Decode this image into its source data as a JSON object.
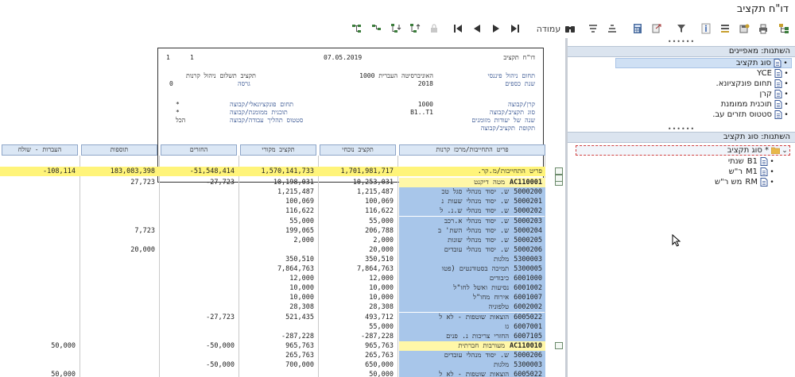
{
  "window": {
    "title": "דו\"ח תקציב"
  },
  "toolbar": {
    "page_label": "עמודה",
    "icons": [
      "refresh-icon",
      "print-icon",
      "export-icon",
      "calculator-icon",
      "sort-asc-icon",
      "sort-desc-icon",
      "binoculars-icon",
      "last-page-icon",
      "next-page-icon",
      "prev-page-icon",
      "first-page-icon",
      "hierarchy-icons"
    ]
  },
  "report_header": {
    "title": "דו\"ח תקציב",
    "date": "07.05.2019",
    "page_a": "1",
    "page_b": "1",
    "fields": [
      {
        "label": "תחום ניהול פיננסי",
        "value": "1000 האוניברסיטה העברית"
      },
      {
        "label": "שנת כספים",
        "value": "2018"
      },
      {
        "label": "תקציב תשלום ניהול קרנות",
        "value": ""
      },
      {
        "label": "גרסה",
        "value": "0"
      },
      {
        "label": "קרן/קבוצה",
        "value": "1000"
      },
      {
        "label": "סוג תקציב/קבוצה",
        "value": "B1..T1"
      },
      {
        "label": "שנה של יעודות מזומנים",
        "value": ""
      },
      {
        "label": "תקופת תקציב/קבוצה",
        "value": ""
      },
      {
        "label": "תחום פונקציונאלי/קבוצה",
        "value": "*"
      },
      {
        "label": "תוכנית ממומנת/קבוצה",
        "value": "*"
      },
      {
        "label": "סטטוס תהליך עבודה/קבוצה",
        "value": "הכל"
      }
    ]
  },
  "columns": {
    "name": "פריט התחייבות/מרכז קרנות",
    "current": "תקציב נוכחי",
    "original": "תקציב מקורי",
    "returns": "החזרים",
    "additions": "תוספות",
    "transfers": "העברות - שולח"
  },
  "rows": [
    {
      "kind": "total",
      "code": "",
      "name": "פריט התחייבות/מ.קר.",
      "current": "1,701,981,717",
      "original": "1,570,141,733",
      "returns": "-51,548,414",
      "additions": "183,083,398",
      "transfers": "-108,114"
    },
    {
      "kind": "sub",
      "code": "AC110001",
      "name": "מטה דיקנט",
      "current": "10,253,031",
      "original": "10,198,031",
      "returns": "-27,723",
      "additions": "27,723",
      "transfers": ""
    },
    {
      "kind": "item",
      "code": "5000200",
      "name": "ש. יסוד מנהלי סגל טכ",
      "current": "1,215,487",
      "original": "1,215,487",
      "returns": "",
      "additions": "",
      "transfers": ""
    },
    {
      "kind": "item",
      "code": "5000201",
      "name": "ש. יסוד מנהלי שעות נ",
      "current": "100,069",
      "original": "100,069",
      "returns": "",
      "additions": "",
      "transfers": ""
    },
    {
      "kind": "item",
      "code": "5000202",
      "name": "ש. יסוד מנהלי ש.נ. ל",
      "current": "116,622",
      "original": "116,622",
      "returns": "",
      "additions": "",
      "transfers": ""
    },
    {
      "kind": "item",
      "code": "5000203",
      "name": "ש. יסוד מנהלי א.רכב",
      "current": "55,000",
      "original": "55,000",
      "returns": "",
      "additions": "",
      "transfers": ""
    },
    {
      "kind": "item",
      "code": "5000204",
      "name": "ש. יסוד מנהלי השת' ב",
      "current": "206,788",
      "original": "199,065",
      "returns": "",
      "additions": "7,723",
      "transfers": ""
    },
    {
      "kind": "item",
      "code": "5000205",
      "name": "ש. יסוד מנהלי שונות",
      "current": "2,000",
      "original": "2,000",
      "returns": "",
      "additions": "",
      "transfers": ""
    },
    {
      "kind": "item",
      "code": "5000206",
      "name": "ש. יסוד מנהלי עובדים",
      "current": "20,000",
      "original": "",
      "returns": "",
      "additions": "20,000",
      "transfers": ""
    },
    {
      "kind": "item",
      "code": "5300003",
      "name": "מלגות",
      "current": "350,510",
      "original": "350,510",
      "returns": "",
      "additions": "",
      "transfers": ""
    },
    {
      "kind": "item",
      "code": "5300005",
      "name": "תמיכה בסטודנטים (פטו",
      "current": "7,864,763",
      "original": "7,864,763",
      "returns": "",
      "additions": "",
      "transfers": ""
    },
    {
      "kind": "item",
      "code": "6001000",
      "name": "כיבודים",
      "current": "12,000",
      "original": "12,000",
      "returns": "",
      "additions": "",
      "transfers": ""
    },
    {
      "kind": "item",
      "code": "6001002",
      "name": "נסיעות ואשל לחו\"ל",
      "current": "10,000",
      "original": "10,000",
      "returns": "",
      "additions": "",
      "transfers": ""
    },
    {
      "kind": "item",
      "code": "6001007",
      "name": "אירוח מחו\"ל",
      "current": "10,000",
      "original": "10,000",
      "returns": "",
      "additions": "",
      "transfers": ""
    },
    {
      "kind": "item",
      "code": "6002002",
      "name": "טלפוניה",
      "current": "28,308",
      "original": "28,308",
      "returns": "",
      "additions": "",
      "transfers": ""
    },
    {
      "kind": "item",
      "code": "6005022",
      "name": "הוצאות שוטפות - לא ל",
      "current": "493,712",
      "original": "521,435",
      "returns": "-27,723",
      "additions": "",
      "transfers": ""
    },
    {
      "kind": "item",
      "code": "6007001",
      "name": "גז",
      "current": "55,000",
      "original": "",
      "returns": "",
      "additions": "",
      "transfers": ""
    },
    {
      "kind": "item",
      "code": "6007105",
      "name": "החזרי צריכות נ. פנים",
      "current": "-287,228",
      "original": "-287,228",
      "returns": "",
      "additions": "",
      "transfers": ""
    },
    {
      "kind": "sub",
      "code": "AC110010",
      "name": "מעורבות חברתית",
      "current": "965,763",
      "original": "965,763",
      "returns": "-50,000",
      "additions": "",
      "transfers": "50,000"
    },
    {
      "kind": "item",
      "code": "5000206",
      "name": "ש. יסוד מנהלי עובדים",
      "current": "265,763",
      "original": "265,763",
      "returns": "",
      "additions": "",
      "transfers": ""
    },
    {
      "kind": "item",
      "code": "5300003",
      "name": "מלגות",
      "current": "650,000",
      "original": "700,000",
      "returns": "-50,000",
      "additions": "",
      "transfers": ""
    },
    {
      "kind": "item",
      "code": "6005022",
      "name": "הוצאות שוטפות - לא ל",
      "current": "50,000",
      "original": "",
      "returns": "",
      "additions": "",
      "transfers": "50,000"
    }
  ],
  "attributes_panel": {
    "title": "השתנות: מאפיינים",
    "items": [
      {
        "label": "סוג תקציב",
        "selected": true,
        "icon": "document-icon"
      },
      {
        "label": "YCE",
        "selected": false,
        "icon": "document-icon"
      },
      {
        "label": "תחום פונקציונא.",
        "selected": false,
        "icon": "document-icon"
      },
      {
        "label": "קרן",
        "selected": false,
        "icon": "document-icon"
      },
      {
        "label": "תוכנית ממומנת",
        "selected": false,
        "icon": "document-icon"
      },
      {
        "label": "סטטוס תזרים עב.",
        "selected": false,
        "icon": "document-icon"
      }
    ]
  },
  "tree_panel": {
    "title": "השתנות: סוג תקציב",
    "root": "* סוג תקציב",
    "children": [
      {
        "code": "B1",
        "label": "שנתי"
      },
      {
        "code": "M1",
        "label": "ר\"ש"
      },
      {
        "code": "RM",
        "label": "מש ר\"ש"
      }
    ]
  },
  "colors": {
    "total_row": "#fff47a",
    "name_cell": "#a8c6ea",
    "header_cell": "#dbe7f5",
    "panel_header": "#dbe4ef"
  }
}
